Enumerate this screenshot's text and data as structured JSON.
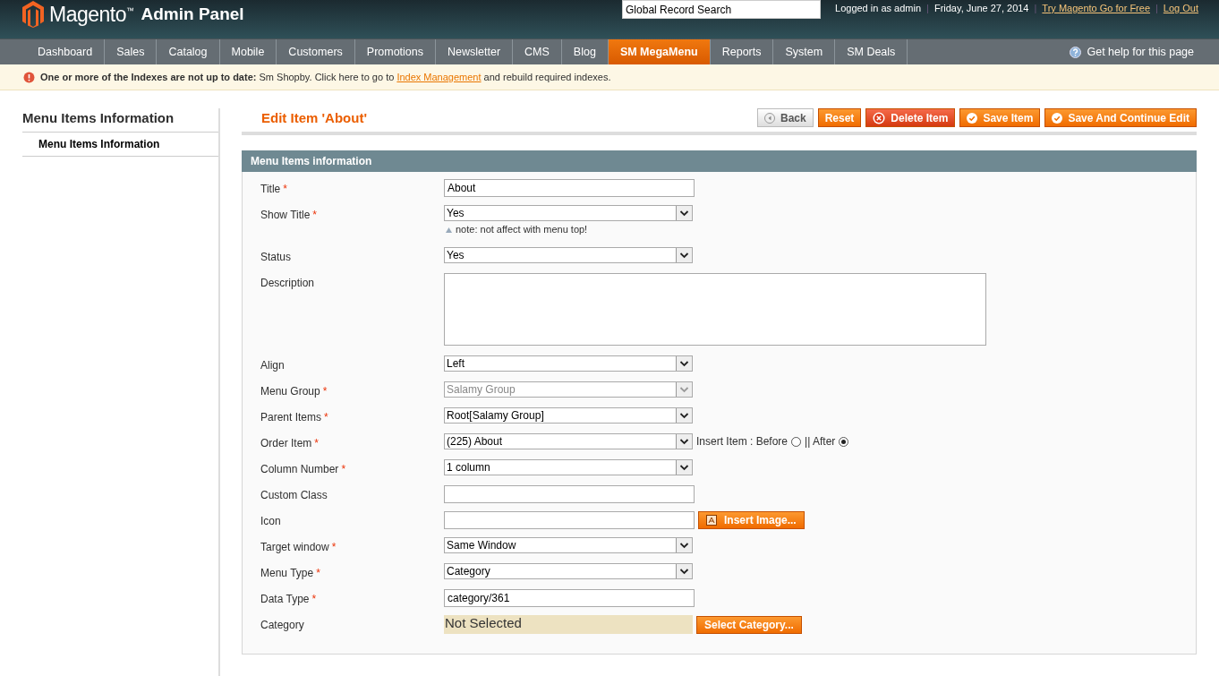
{
  "header": {
    "logo": "Magento",
    "logo_tm": "™",
    "logo_sub": "Admin Panel",
    "search": {
      "placeholder": "Global Record Search"
    },
    "links": [
      {
        "text": "Logged in as admin",
        "kind": "text"
      },
      {
        "text": "Friday, June 27, 2014",
        "kind": "text"
      },
      {
        "text": "Try Magento Go for Free",
        "kind": "link"
      },
      {
        "text": "Log Out",
        "kind": "link"
      }
    ],
    "separator": "|"
  },
  "nav": {
    "items": [
      {
        "label": "Dashboard",
        "selected": false
      },
      {
        "label": "Sales",
        "selected": false
      },
      {
        "label": "Catalog",
        "selected": false
      },
      {
        "label": "Mobile",
        "selected": false
      },
      {
        "label": "Customers",
        "selected": false
      },
      {
        "label": "Promotions",
        "selected": false
      },
      {
        "label": "Newsletter",
        "selected": false
      },
      {
        "label": "CMS",
        "selected": false
      },
      {
        "label": "Blog",
        "selected": false
      },
      {
        "label": "SM MegaMenu",
        "selected": true
      },
      {
        "label": "Reports",
        "selected": false
      },
      {
        "label": "System",
        "selected": false
      },
      {
        "label": "SM Deals",
        "selected": false
      }
    ],
    "help": "Get help for this page"
  },
  "notice": {
    "bold": "One or more of the Indexes are not up to date:",
    "text": "Sm Shopby. Click here to go to",
    "link": "Index Management",
    "tail": "and rebuild required indexes."
  },
  "sidebar": {
    "title": "Menu Items Information",
    "tabs": [
      {
        "label": "Menu Items Information",
        "selected": true
      }
    ]
  },
  "page": {
    "title": "Edit Item 'About'",
    "buttons": [
      {
        "label": "Back",
        "kind": "back"
      },
      {
        "label": "Reset",
        "kind": "plain"
      },
      {
        "label": "Delete Item",
        "kind": "delete"
      },
      {
        "label": "Save Item",
        "kind": "save"
      },
      {
        "label": "Save And Continue Edit",
        "kind": "save"
      }
    ]
  },
  "fieldset": {
    "title": "Menu Items information",
    "fields": [
      {
        "label": "Title",
        "mark": "*",
        "kind": "text",
        "value": "About"
      },
      {
        "label": "Show Title",
        "mark": "*",
        "kind": "select",
        "value": "Yes",
        "note": "note: not affect with menu top!"
      },
      {
        "label": "Status",
        "kind": "select",
        "value": "Yes"
      },
      {
        "label": "Description",
        "kind": "textarea"
      },
      {
        "label": "Align",
        "kind": "select",
        "value": "Left"
      },
      {
        "label": "Menu Group",
        "mark": "*",
        "kind": "select",
        "value": "Salamy Group",
        "disabled": true
      },
      {
        "label": "Parent Items",
        "mark": "*",
        "kind": "select",
        "value": "Root[Salamy Group]"
      },
      {
        "label": "Order Item",
        "mark": "*",
        "kind": "select",
        "value": "(225) About",
        "radios": [
          {
            "label": "Insert Item : Before",
            "selected": false
          },
          {
            "label": "|| After",
            "selected": true
          }
        ]
      },
      {
        "label": "Column Number",
        "mark": "*",
        "kind": "select",
        "value": "1 column"
      },
      {
        "label": "Custom Class",
        "kind": "text"
      },
      {
        "label": "Icon",
        "kind": "text",
        "button": "Insert Image..."
      },
      {
        "label": "Target window",
        "mark": "*",
        "kind": "select",
        "value": "Same Window"
      },
      {
        "label": "Menu Type",
        "mark": "*",
        "kind": "select",
        "value": "Category"
      },
      {
        "label": "Data Type",
        "mark": "*",
        "kind": "text",
        "value": "category/361"
      },
      {
        "label": "Category",
        "kind": "static",
        "value": "Not Selected",
        "button": "Select Category..."
      }
    ]
  }
}
